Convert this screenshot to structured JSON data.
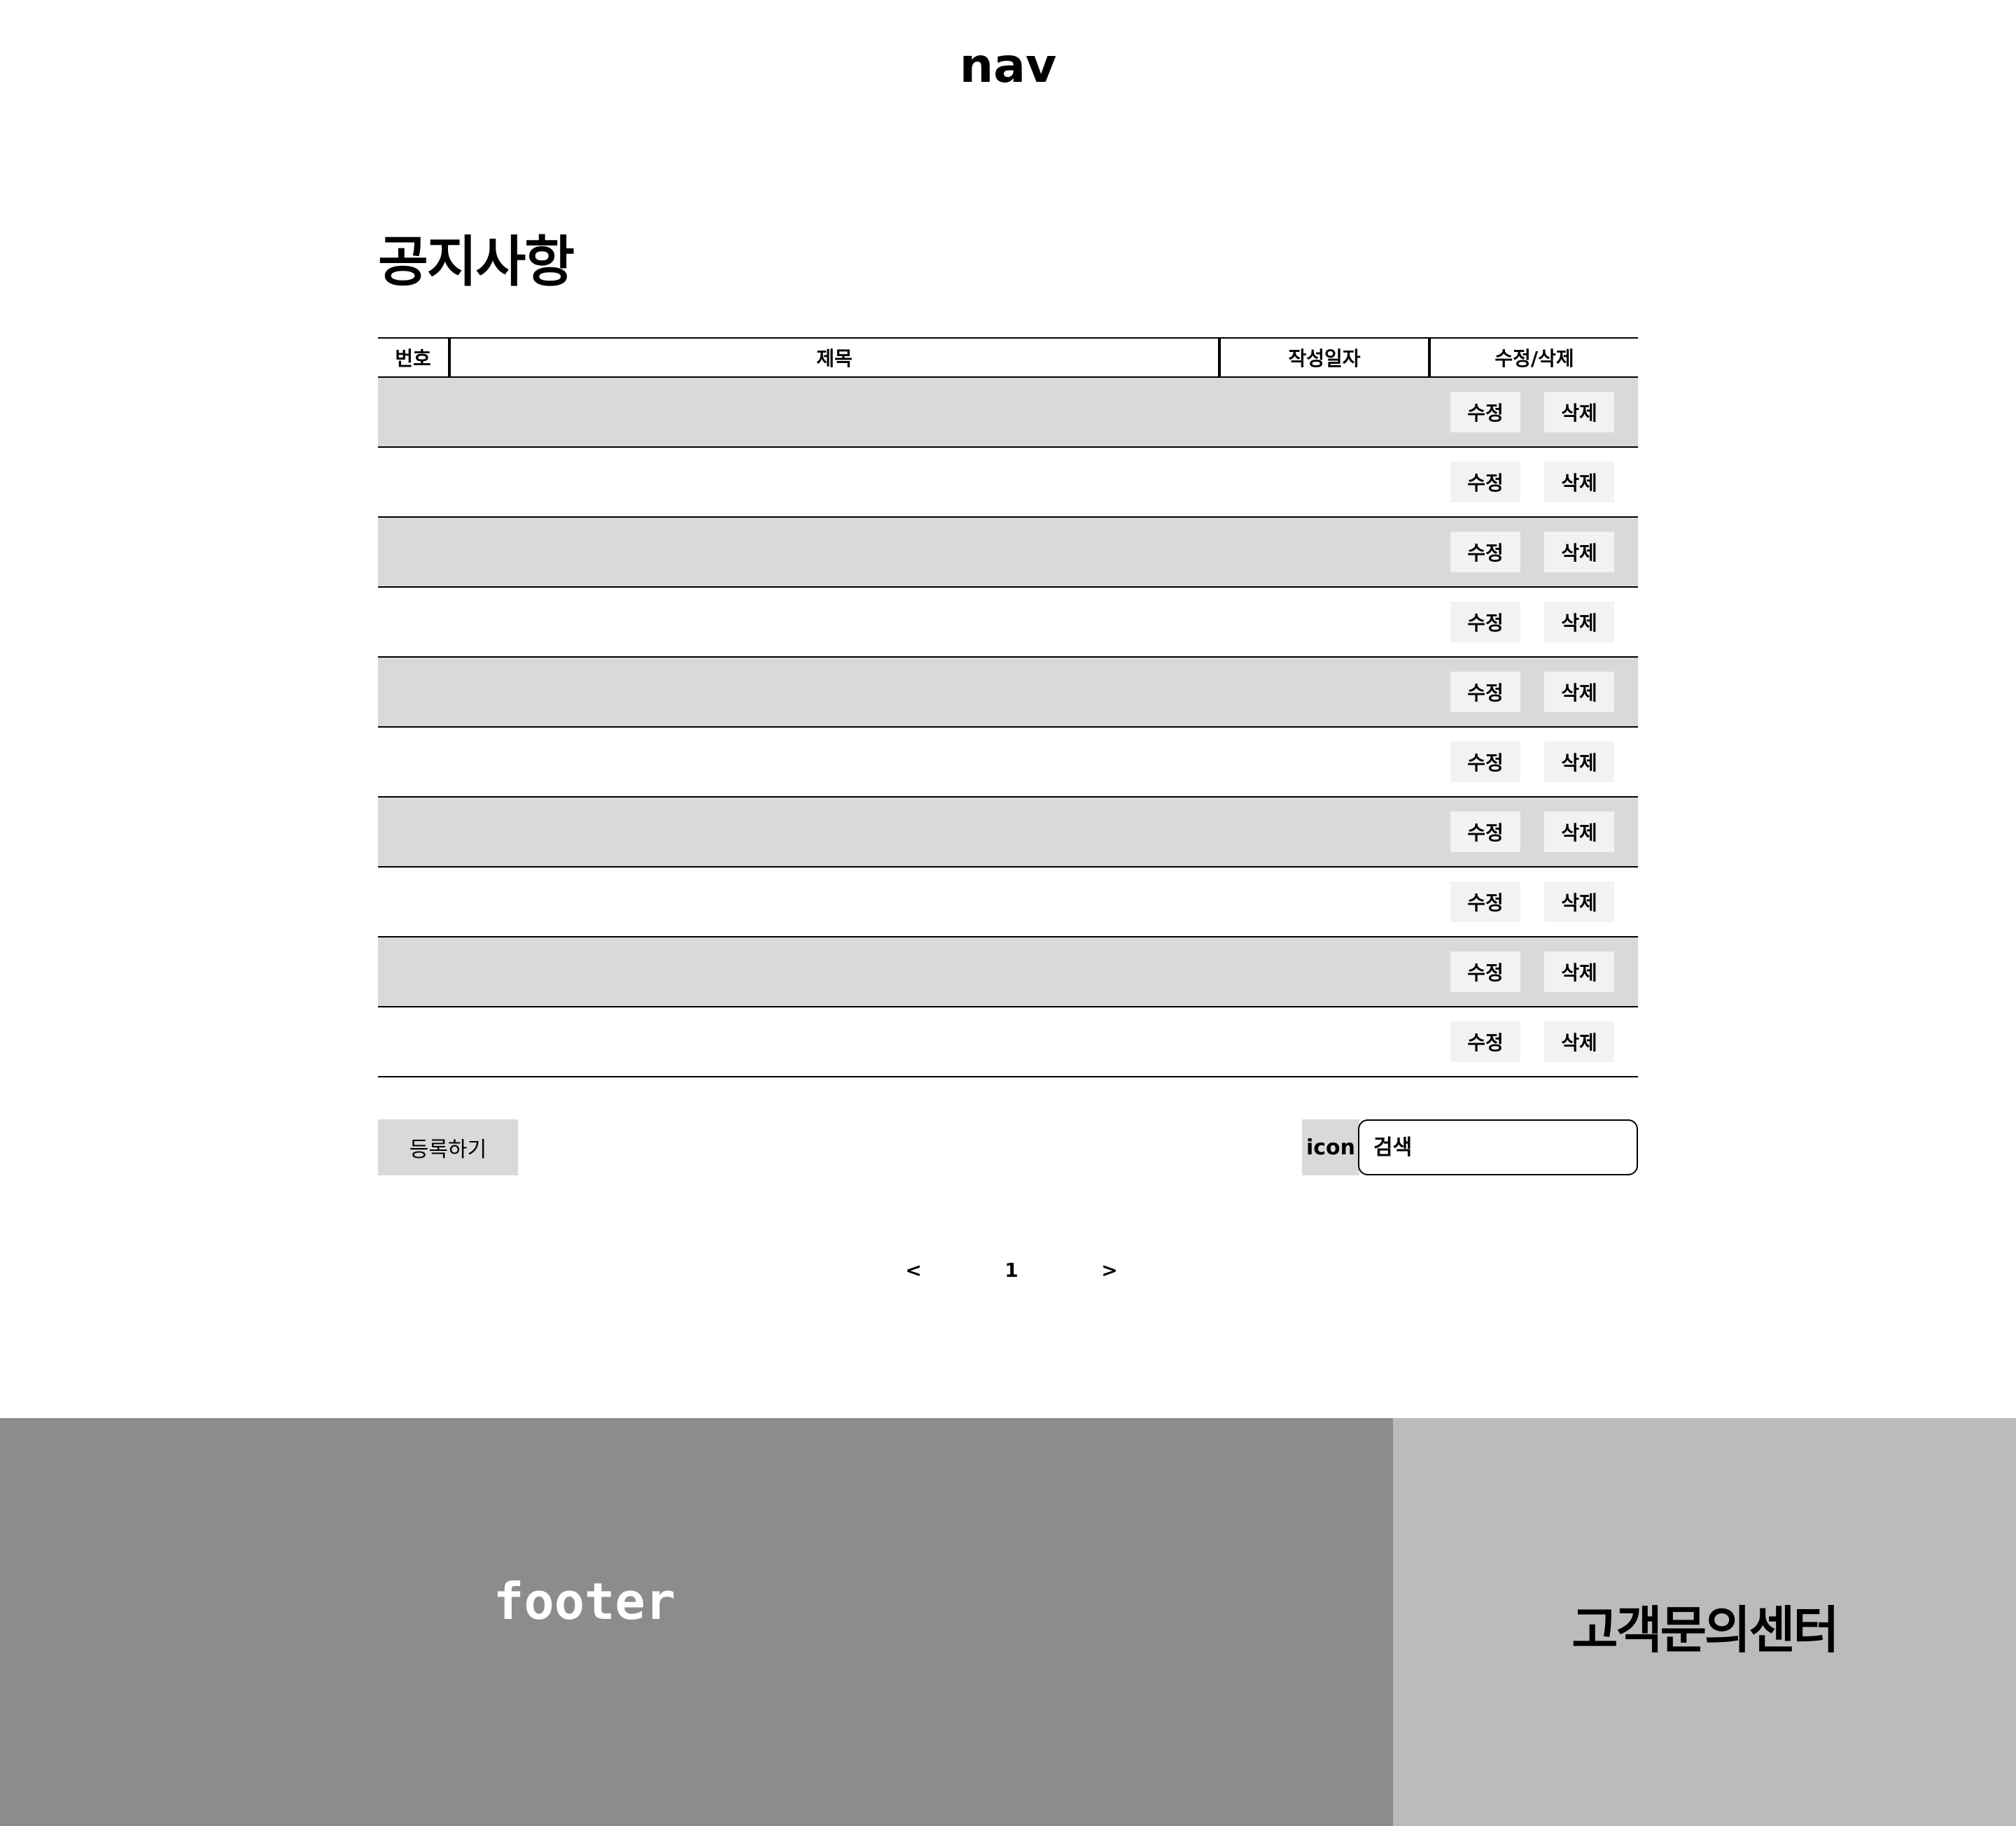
{
  "nav": {
    "label": "nav"
  },
  "page": {
    "title": "공지사항"
  },
  "table": {
    "headers": {
      "number": "번호",
      "title": "제목",
      "date": "작성일자",
      "actions": "수정/삭제"
    },
    "rows": [
      {
        "edit_label": "수정",
        "delete_label": "삭제"
      },
      {
        "edit_label": "수정",
        "delete_label": "삭제"
      },
      {
        "edit_label": "수정",
        "delete_label": "삭제"
      },
      {
        "edit_label": "수정",
        "delete_label": "삭제"
      },
      {
        "edit_label": "수정",
        "delete_label": "삭제"
      },
      {
        "edit_label": "수정",
        "delete_label": "삭제"
      },
      {
        "edit_label": "수정",
        "delete_label": "삭제"
      },
      {
        "edit_label": "수정",
        "delete_label": "삭제"
      },
      {
        "edit_label": "수정",
        "delete_label": "삭제"
      },
      {
        "edit_label": "수정",
        "delete_label": "삭제"
      }
    ]
  },
  "controls": {
    "register_label": "등록하기",
    "search_icon_label": "icon",
    "search_placeholder": "검색"
  },
  "pagination": {
    "prev": "<",
    "current": "1",
    "next": ">"
  },
  "footer": {
    "label": "footer",
    "cs_center": "고객문의센터"
  },
  "colors": {
    "row_shaded": "#d9d9d9",
    "button_bg": "#f2f2f2",
    "footer_bg": "#8c8c8c",
    "cs_bg": "#bbbbbb"
  }
}
